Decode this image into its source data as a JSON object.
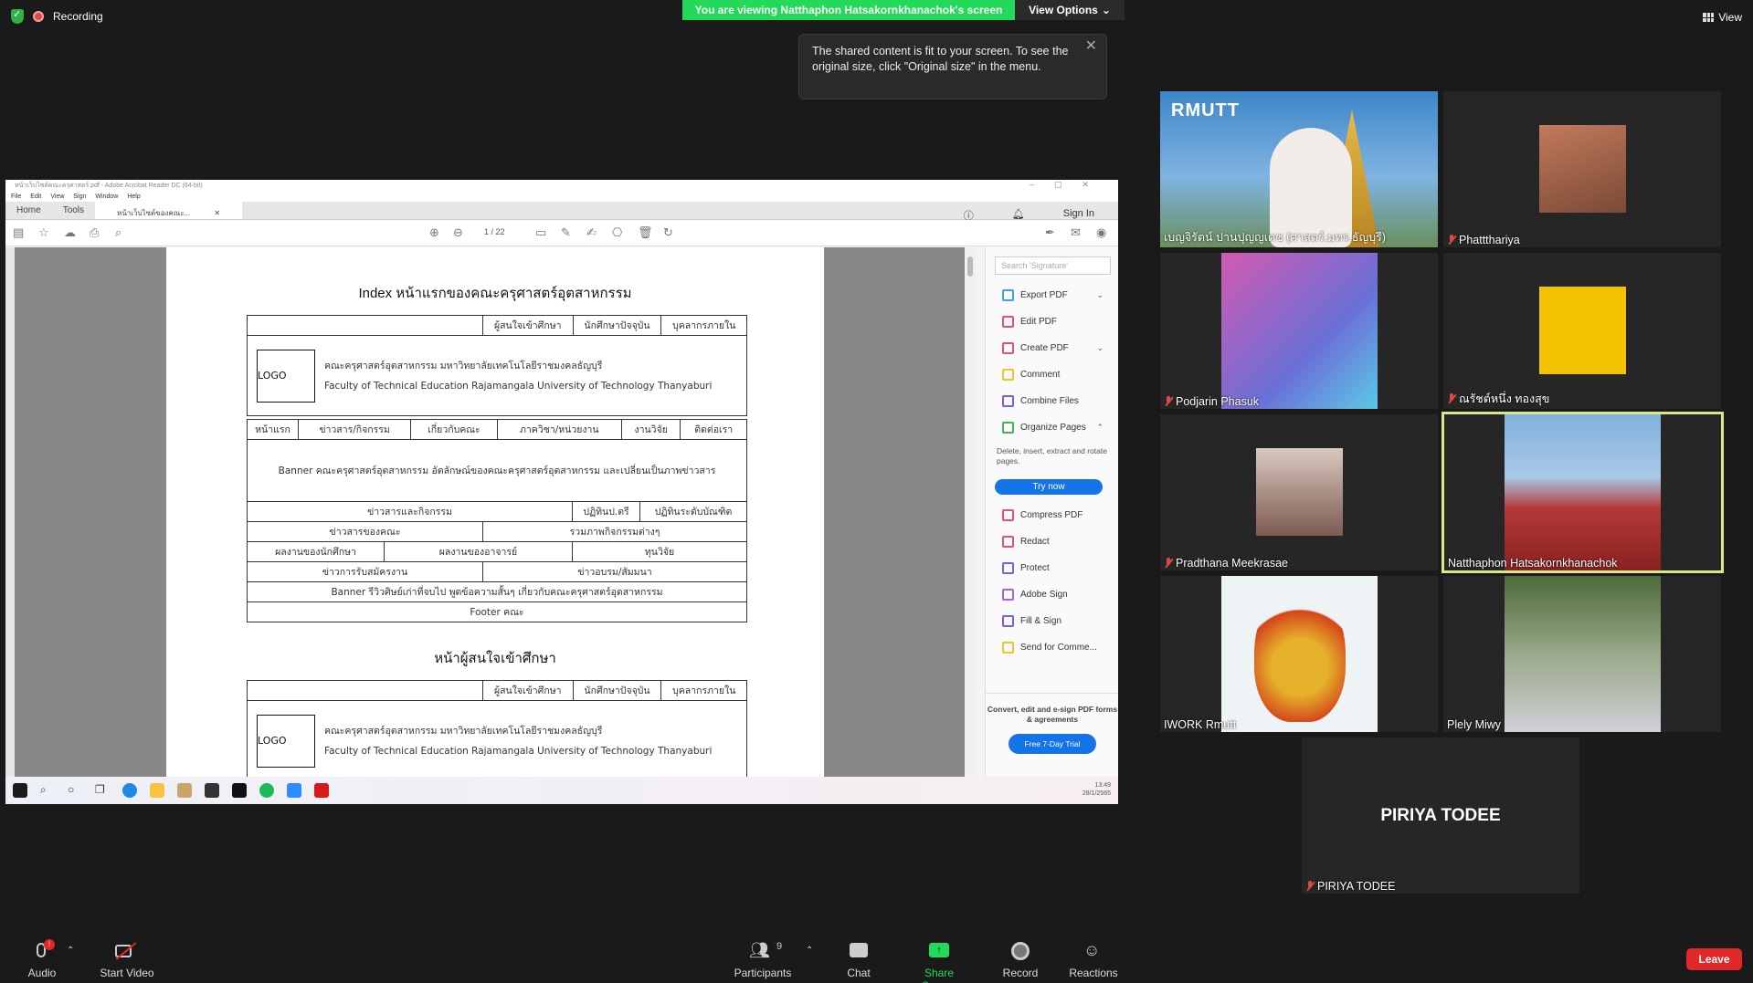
{
  "top": {
    "recording_label": "Recording",
    "viewing_banner": "You are viewing Natthaphon Hatsakornkhanachok's screen",
    "view_options": "View Options",
    "view_label": "View",
    "tooltip_text": "The shared content is fit to your screen. To see the original size, click \"Original size\" in the menu."
  },
  "acrobat": {
    "window_title": "หน้าเว็บไซต์คณะครุศาสตร์.pdf - Adobe Acrobat Reader DC (64-bit)",
    "menu": [
      "File",
      "Edit",
      "View",
      "Sign",
      "Window",
      "Help"
    ],
    "tabs": {
      "home": "Home",
      "tools": "Tools",
      "doc": "หน้าเว็บไซต์ของคณะ..."
    },
    "sign_in": "Sign In",
    "page_current": "1",
    "page_total": "/ 22",
    "search_placeholder": "Search 'Signature'",
    "tools": [
      {
        "label": "Export PDF",
        "color": "#3aa3e0",
        "chevron": "⌄"
      },
      {
        "label": "Edit PDF",
        "color": "#e0527a",
        "chevron": ""
      },
      {
        "label": "Create PDF",
        "color": "#e0527a",
        "chevron": "⌄"
      },
      {
        "label": "Comment",
        "color": "#f2c230",
        "chevron": ""
      },
      {
        "label": "Combine Files",
        "color": "#7b5fd6",
        "chevron": ""
      },
      {
        "label": "Organize Pages",
        "color": "#4caf50",
        "chevron": "⌃"
      }
    ],
    "organize_desc": "Delete, insert, extract and rotate pages.",
    "try_now": "Try now",
    "tools2": [
      {
        "label": "Compress PDF",
        "color": "#e0527a"
      },
      {
        "label": "Redact",
        "color": "#e0527a"
      },
      {
        "label": "Protect",
        "color": "#7b5fd6"
      },
      {
        "label": "Adobe Sign",
        "color": "#b05fd6"
      },
      {
        "label": "Fill & Sign",
        "color": "#7b5fd6"
      },
      {
        "label": "Send for Comme...",
        "color": "#f2c230"
      }
    ],
    "promo_text": "Convert, edit and e-sign PDF forms & agreements",
    "promo_button": "Free 7-Day Trial",
    "clock_time": "13:49",
    "clock_date": "28/1/2565"
  },
  "doc": {
    "heading1": "Index หน้าแรกของคณะครุศาสตร์อุตสาหกรรม",
    "nav_top": [
      "ผู้สนใจเข้าศึกษา",
      "นักศึกษาปัจจุบัน",
      "บุคลากรภายใน"
    ],
    "logo": "LOGO",
    "faculty_th": "คณะครุศาสตร์อุตสาหกรรม มหาวิทยาลัยเทคโนโลยีราชมงคลธัญบุรี",
    "faculty_en": "Faculty of Technical Education Rajamangala University of Technology Thanyaburi",
    "menu_row": [
      "หน้าแรก",
      "ข่าวสาร/กิจกรรม",
      "เกี่ยวกับคณะ",
      "ภาควิชา/หน่วยงาน",
      "งานวิจัย",
      "ติดต่อเรา"
    ],
    "banner1": "Banner คณะครุศาสตร์อุตสาหกรรม อัตลักษณ์ของคณะครุศาสตร์อุตสาหกรรม และเปลี่ยนเป็นภาพข่าวสาร",
    "row_news": [
      "ข่าวสารและกิจกรรม",
      "ปฏิทินป.ตรี",
      "ปฏิทินระดับบัณฑิต"
    ],
    "row_faculty_news": [
      "ข่าวสารของคณะ",
      "รวมภาพกิจกรรมต่างๆ"
    ],
    "row_works": [
      "ผลงานของนักศึกษา",
      "ผลงานของอาจารย์",
      "ทุนวิจัย"
    ],
    "row_jobs": [
      "ข่าวการรับสมัครงาน",
      "ข่าวอบรม/สัมมนา"
    ],
    "banner2": "Banner รีวิวศิษย์เก่าที่จบไป พูดข้อความสั้นๆ เกี่ยวกับคณะครุศาสตร์อุตสาหกรรม",
    "footer": "Footer คณะ",
    "heading2": "หน้าผู้สนใจเข้าศึกษา"
  },
  "participants_tiles": [
    {
      "name": "เบญจิรัตน์ ปานปุญญเดช (ศาสตร์.มทร.ธัญบุรี)",
      "muted": false
    },
    {
      "name": "Phattthariya",
      "muted": true
    },
    {
      "name": "Podjarin Phasuk",
      "muted": true
    },
    {
      "name": "ณรัชต์หนึ่ง  ทองสุข",
      "muted": true
    },
    {
      "name": "Pradthana Meekrasae",
      "muted": true
    },
    {
      "name": "Natthaphon Hatsakornkhanachok",
      "muted": false
    },
    {
      "name": "IWORK Rmutt",
      "muted": false
    },
    {
      "name": "Plely Miwy",
      "muted": false
    },
    {
      "name": "PIRIYA TODEE",
      "muted": true
    }
  ],
  "tile_logo_text": "RMUTT",
  "bottom": {
    "audio": "Audio",
    "start_video": "Start Video",
    "participants": "Participants",
    "participants_count": "9",
    "chat": "Chat",
    "share_screen": "Share Screen",
    "record": "Record",
    "reactions": "Reactions",
    "leave": "Leave"
  }
}
